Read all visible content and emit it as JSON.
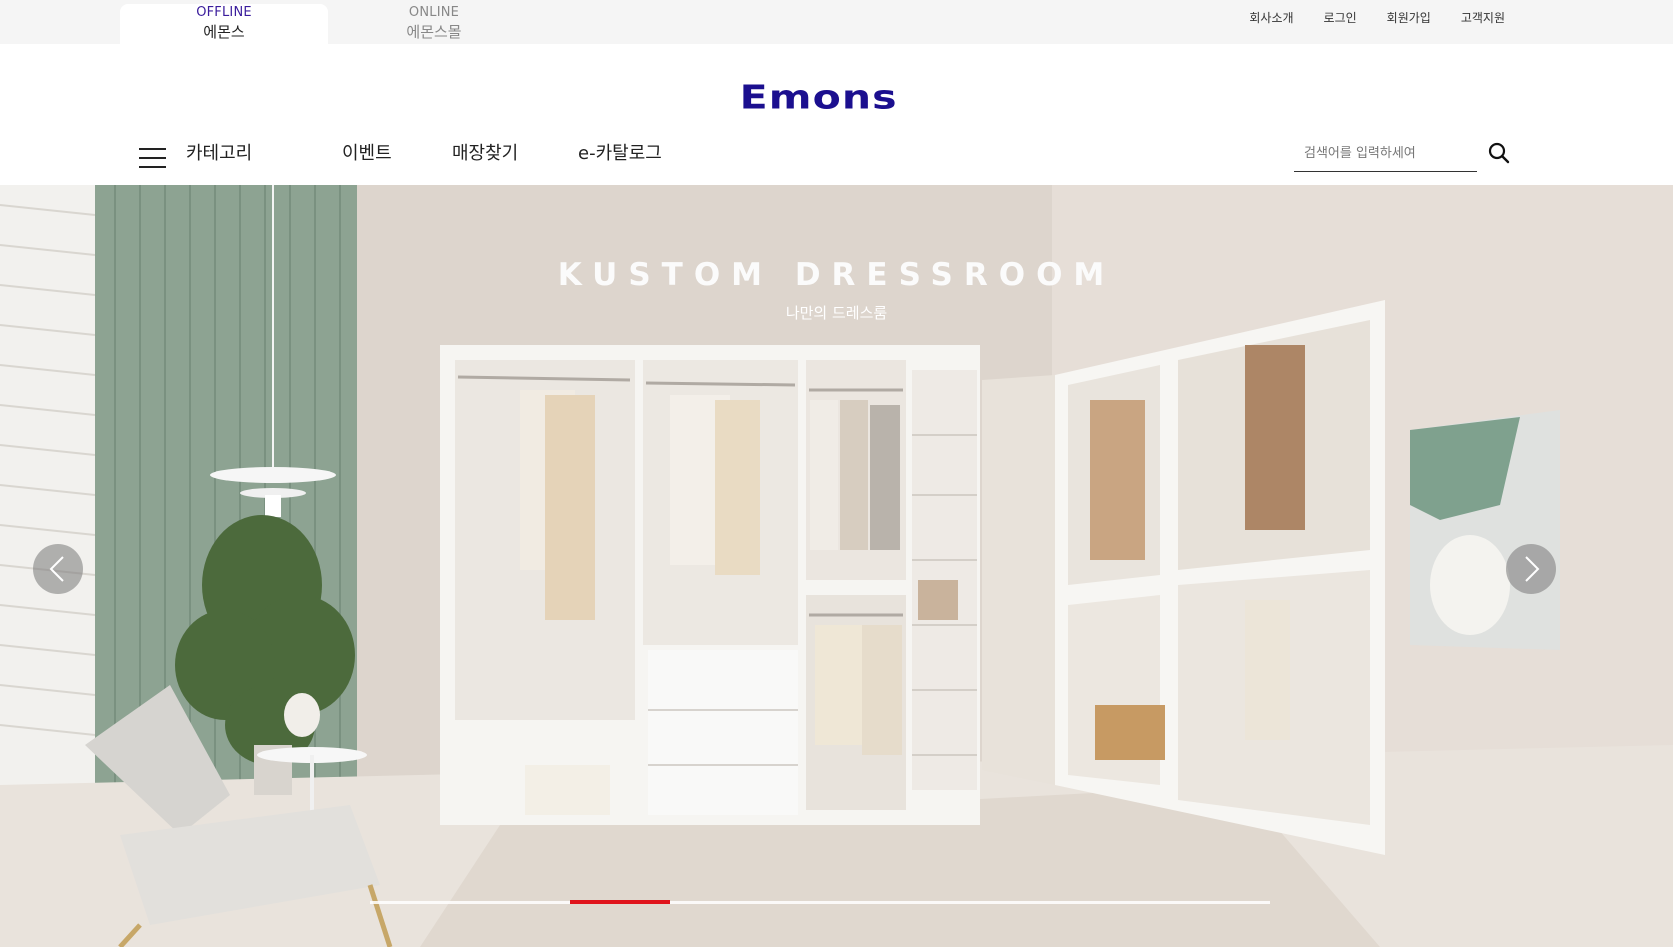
{
  "site_tabs": [
    {
      "en": "OFFLINE",
      "ko": "에몬스",
      "active": true
    },
    {
      "en": "ONLINE",
      "ko": "에몬스몰",
      "active": false
    }
  ],
  "util_links": [
    "회사소개",
    "로그인",
    "회원가입",
    "고객지원"
  ],
  "logo": {
    "text": "Emons",
    "color": "#1b0f8f"
  },
  "nav": {
    "category": "카테고리",
    "items": [
      "이벤트",
      "매장찾기",
      "e-카탈로그"
    ]
  },
  "search": {
    "placeholder": "검색어를 입력하세여",
    "value": ""
  },
  "hero": {
    "title": "KUSTOM DRESSROOM",
    "subtitle": "나만의 드레스룸",
    "slide_progress": {
      "active_index": 2,
      "indicator_color": "#e0141c"
    }
  },
  "colors": {
    "brand": "#1b0f8f",
    "accent_offline": "#3a1c9c",
    "topbar_bg": "#f5f5f5"
  }
}
